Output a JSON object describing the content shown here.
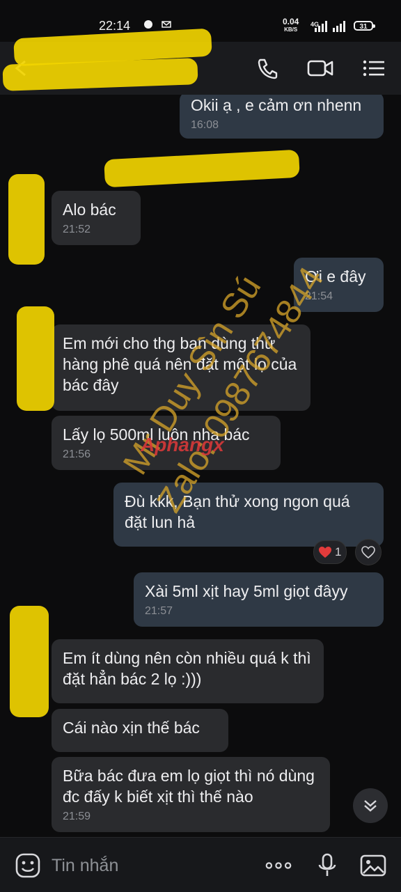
{
  "status": {
    "time": "22:14",
    "speed_value": "0.04",
    "speed_unit": "KB/S",
    "network": "4G",
    "battery": "31"
  },
  "header": {
    "contact_name": "",
    "icons": [
      "phone-icon",
      "video-call-icon",
      "menu-list-icon"
    ]
  },
  "messages": [
    {
      "side": "out",
      "text": "Okii ạ , e cảm ơn nhenn",
      "time": "16:08"
    },
    {
      "side": "in",
      "text": "Alo bác",
      "time": "21:52"
    },
    {
      "side": "out",
      "text": "Ơi e đây",
      "time": "21:54"
    },
    {
      "side": "in",
      "text": "Em mới cho thg bạn dùng thử hàng phê quá nên đặt một lọ của bác đây",
      "time": ""
    },
    {
      "side": "in",
      "text": "Lấy lọ 500ml luôn nha bác",
      "time": "21:56"
    },
    {
      "side": "out",
      "text": "Đù kkk, Bạn thử xong ngon quá đặt lun hả",
      "time": ""
    },
    {
      "side": "out",
      "text": "Xài 5ml xịt hay 5ml giọt đâyy",
      "time": "21:57"
    },
    {
      "side": "in",
      "text": "Em ít dùng nên còn nhiều quá k thì đặt hẳn bác 2 lọ :)))",
      "time": ""
    },
    {
      "side": "in",
      "text": "Cái nào xịn thế bác",
      "time": ""
    },
    {
      "side": "in",
      "text": "Bữa bác đưa em lọ giọt thì nó dùng đc đấy k biết xịt thì thế nào",
      "time": "21:59"
    }
  ],
  "reaction": {
    "emoji": "heart-icon",
    "count": "1"
  },
  "watermark": {
    "line1": "Mr Duy Sìn Sú",
    "line2": "Zalo: 0987674844",
    "logo": "Aphangx"
  },
  "input": {
    "placeholder": "Tin nhắn"
  },
  "colors": {
    "background": "#0c0c0d",
    "incoming_bubble": "#2a2b2e",
    "outgoing_bubble": "#2f3945",
    "watermark": "#d8a52a",
    "redaction": "#f1d400"
  }
}
